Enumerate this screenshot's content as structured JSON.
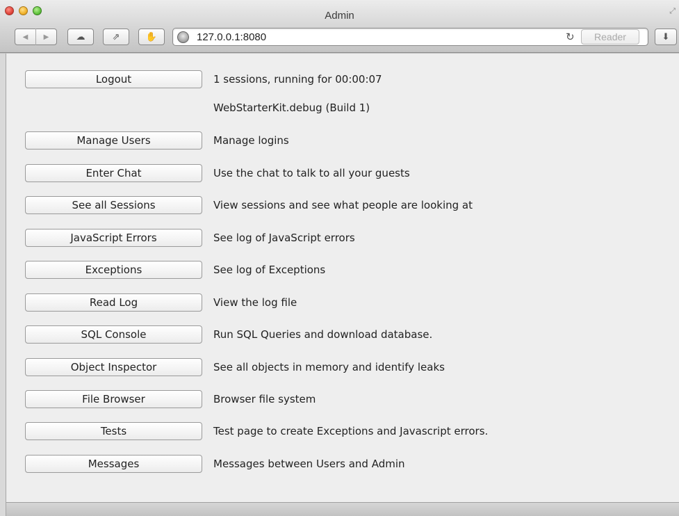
{
  "window": {
    "title": "Admin",
    "url": "127.0.0.1:8080",
    "reader_label": "Reader",
    "resize_glyph": "⤢",
    "back_glyph": "◀",
    "forward_glyph": "▶",
    "cloud_glyph": "☁",
    "share_glyph": "⇗",
    "block_glyph": "✋",
    "reload_glyph": "↻",
    "download_glyph": "⬇"
  },
  "status": {
    "sessions": "1 sessions, running for 00:00:07",
    "build": "WebStarterKit.debug (Build 1)"
  },
  "logout_label": "Logout",
  "items": [
    {
      "button": "Manage Users",
      "description": "Manage logins"
    },
    {
      "button": "Enter Chat",
      "description": "Use the chat to talk to all your guests"
    },
    {
      "button": "See all Sessions",
      "description": "View sessions and see what people are looking at"
    },
    {
      "button": "JavaScript Errors",
      "description": "See log of JavaScript errors"
    },
    {
      "button": "Exceptions",
      "description": "See log of Exceptions"
    },
    {
      "button": "Read Log",
      "description": "View the log file"
    },
    {
      "button": "SQL Console",
      "description": "Run SQL Queries and download database."
    },
    {
      "button": "Object Inspector",
      "description": "See all objects in memory and identify leaks"
    },
    {
      "button": "File Browser",
      "description": "Browser file system"
    },
    {
      "button": "Tests",
      "description": "Test page to create Exceptions and Javascript errors."
    },
    {
      "button": "Messages",
      "description": "Messages between Users and Admin"
    }
  ]
}
